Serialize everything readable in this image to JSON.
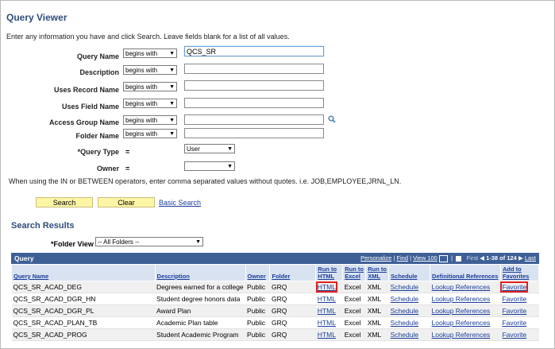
{
  "page_title": "Query Viewer",
  "instructions": "Enter any information you have and click Search. Leave fields blank for a list of all values.",
  "fields": [
    {
      "label": "Query Name",
      "operator": "begins with",
      "value": "QCS_SR"
    },
    {
      "label": "Description",
      "operator": "begins with",
      "value": ""
    },
    {
      "label": "Uses Record Name",
      "operator": "begins with",
      "value": ""
    },
    {
      "label": "Uses Field Name",
      "operator": "begins with",
      "value": ""
    },
    {
      "label": "Access Group Name",
      "operator": "begins with",
      "value": ""
    },
    {
      "label": "Folder Name",
      "operator": "begins with",
      "value": ""
    }
  ],
  "query_type": {
    "label": "*Query Type",
    "equals": "=",
    "value": "User"
  },
  "owner": {
    "label": "Owner",
    "equals": "=",
    "value": ""
  },
  "note": "When using the IN or BETWEEN operators, enter comma separated values without quotes. i.e. JOB,EMPLOYEE,JRNL_LN.",
  "buttons": {
    "search": "Search",
    "clear": "Clear",
    "basic_search": "Basic Search"
  },
  "results": {
    "title": "Search Results",
    "folder_view_label": "*Folder View",
    "folder_view_value": "-- All Folders --",
    "grid_title": "Query",
    "nav": {
      "personalize": "Personalize",
      "find": "Find",
      "view": "View 100",
      "first": "First",
      "range": "1-38 of 124",
      "last": "Last"
    },
    "columns": [
      "Query Name",
      "Description",
      "Owner",
      "Folder",
      "Run to HTML",
      "Run to Excel",
      "Run to XML",
      "Schedule",
      "Definitional References",
      "Add to Favorites"
    ],
    "rows": [
      {
        "name": "QCS_SR_ACAD_DEG",
        "desc": "Degrees earned for a college",
        "owner": "Public",
        "folder": "GRQ",
        "html": "HTML",
        "excel": "Excel",
        "xml": "XML",
        "schedule": "Schedule",
        "refs": "Lookup References",
        "fav": "Favorite"
      },
      {
        "name": "QCS_SR_ACAD_DGR_HN",
        "desc": "Student degree honors data",
        "owner": "Public",
        "folder": "GRQ",
        "html": "HTML",
        "excel": "Excel",
        "xml": "XML",
        "schedule": "Schedule",
        "refs": "Lookup References",
        "fav": "Favorite"
      },
      {
        "name": "QCS_SR_ACAD_DGR_PL",
        "desc": "Award Plan",
        "owner": "Public",
        "folder": "GRQ",
        "html": "HTML",
        "excel": "Excel",
        "xml": "XML",
        "schedule": "Schedule",
        "refs": "Lookup References",
        "fav": "Favorite"
      },
      {
        "name": "QCS_SR_ACAD_PLAN_TB",
        "desc": "Academic Plan table",
        "owner": "Public",
        "folder": "GRQ",
        "html": "HTML",
        "excel": "Excel",
        "xml": "XML",
        "schedule": "Schedule",
        "refs": "Lookup References",
        "fav": "Favorite"
      },
      {
        "name": "QCS_SR_ACAD_PROG",
        "desc": "Student Academic Program",
        "owner": "Public",
        "folder": "GRQ",
        "html": "HTML",
        "excel": "Excel",
        "xml": "XML",
        "schedule": "Schedule",
        "refs": "Lookup References",
        "fav": "Favorite"
      }
    ]
  },
  "colors": {
    "accent": "#3e5f96",
    "title": "#2f4d7a",
    "button": "#fdf5a6",
    "highlight": "#e02020",
    "link": "#1a3e9a"
  }
}
